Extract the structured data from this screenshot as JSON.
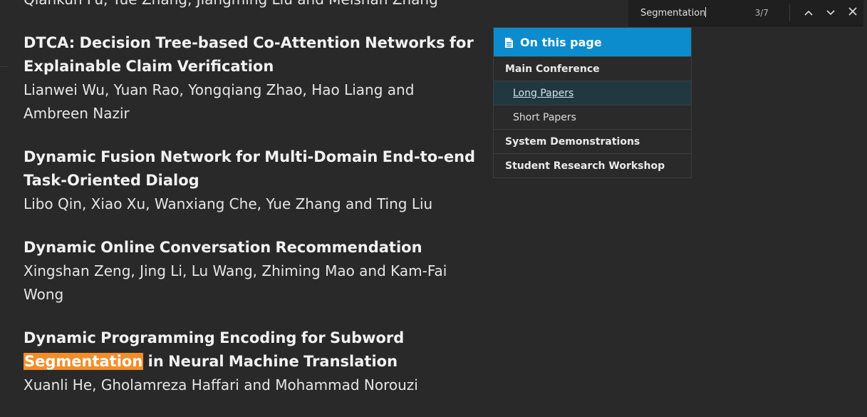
{
  "papers": [
    {
      "title": "",
      "authors": "Qiankun Fu, Yue Zhang, Jiangming Liu and Meishan Zhang"
    },
    {
      "title": "DTCA: Decision Tree-based Co-Attention Networks for Explainable Claim Verification",
      "authors": "Lianwei Wu, Yuan Rao, Yongqiang Zhao, Hao Liang and Ambreen Nazir"
    },
    {
      "title": "Dynamic Fusion Network for Multi-Domain End-to-end Task-Oriented Dialog",
      "authors": "Libo Qin, Xiao Xu, Wanxiang Che, Yue Zhang and Ting Liu"
    },
    {
      "title": "Dynamic Online Conversation Recommendation",
      "authors": "Xingshan Zeng, Jing Li, Lu Wang, Zhiming Mao and Kam-Fai Wong"
    },
    {
      "title_before": "Dynamic Programming Encoding for Subword ",
      "title_highlight": "Segmentation",
      "title_after": " in Neural Machine Translation",
      "authors": "Xuanli He, Gholamreza Haffari and Mohammad Norouzi"
    }
  ],
  "toc": {
    "heading": "On this page",
    "items": [
      {
        "label": "Main Conference",
        "level": 1
      },
      {
        "label": "Long Papers",
        "level": 2,
        "active": true
      },
      {
        "label": "Short Papers",
        "level": 2
      },
      {
        "label": "System Demonstrations",
        "level": 1
      },
      {
        "label": "Student Research Workshop",
        "level": 1
      }
    ]
  },
  "findbar": {
    "query": "Segmentation",
    "count": "3/7",
    "icons": [
      "chevron-up-icon",
      "chevron-down-icon",
      "close-icon"
    ]
  },
  "colors": {
    "background": "#292929",
    "highlight": "#f28e29",
    "toc_header": "#0c8ccc"
  }
}
